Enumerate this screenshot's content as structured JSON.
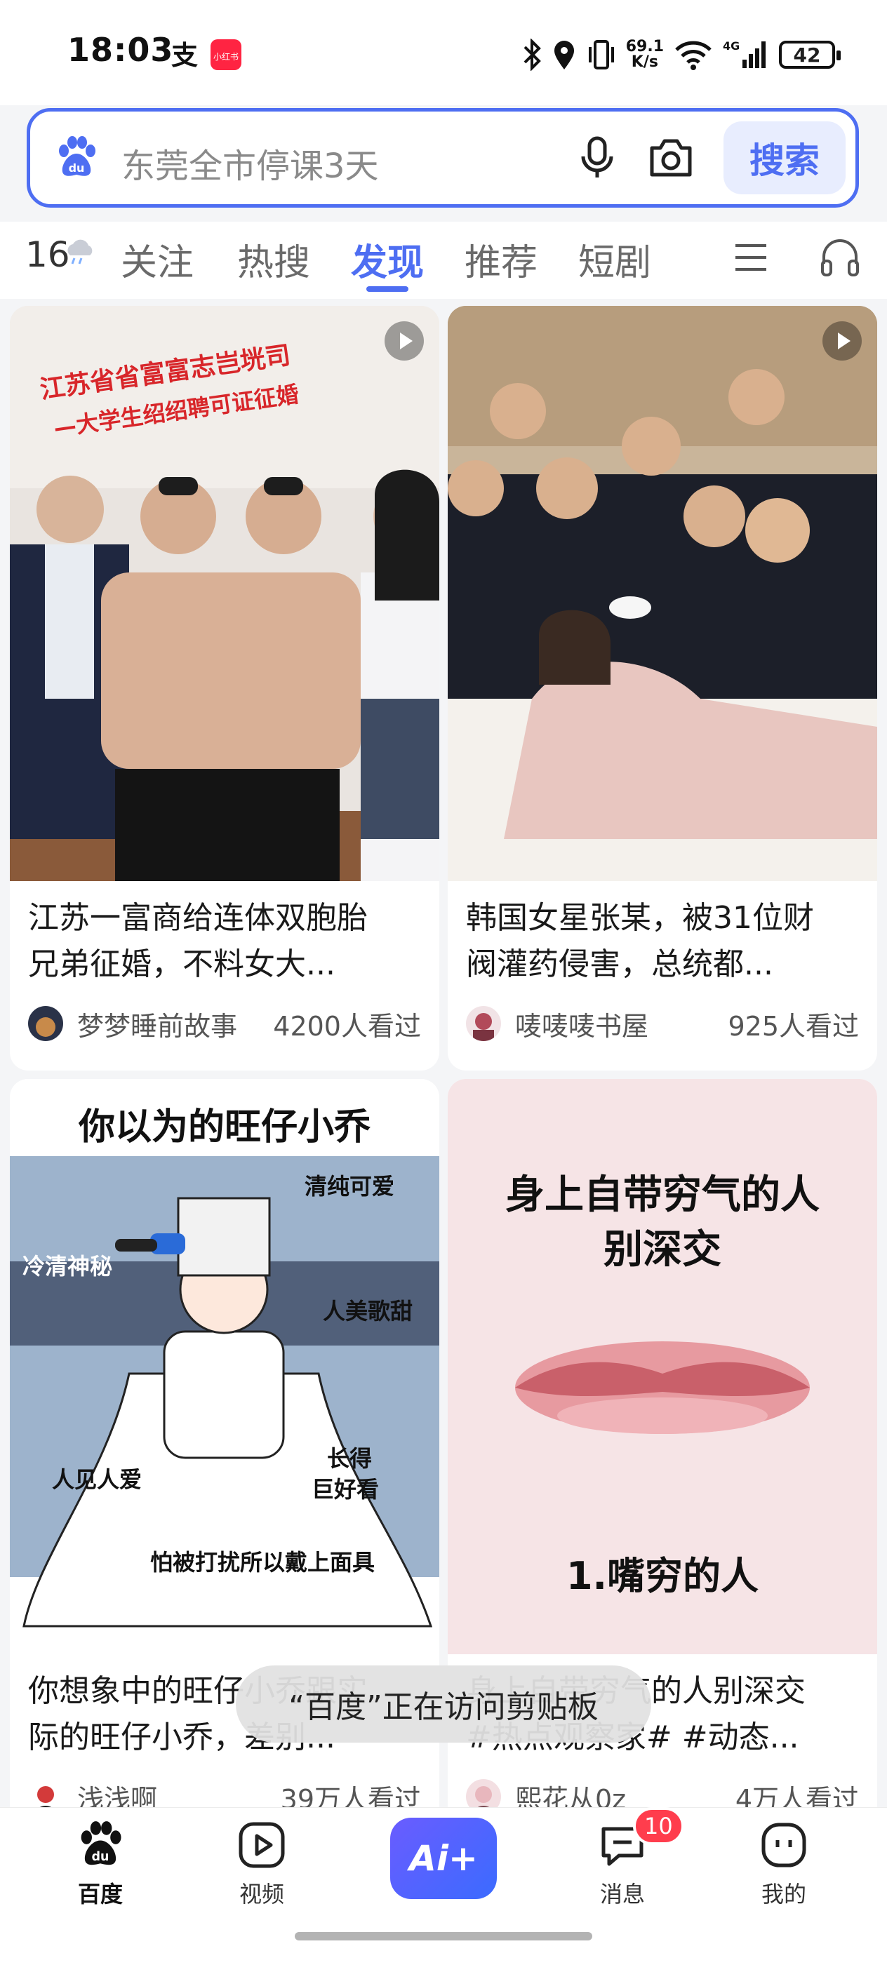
{
  "status_bar": {
    "time": "18:03",
    "net_speed_value": "69.1",
    "net_speed_unit": "K/s",
    "network": "4G",
    "wifi_label": "6",
    "battery": "42",
    "app_icons": [
      "alipay-icon",
      "xiaohongshu-icon"
    ]
  },
  "search": {
    "query": "东莞全市停课3天",
    "button_label": "搜索",
    "accent_color": "#4e6ef2"
  },
  "tabs": {
    "weather": "16°",
    "items": [
      {
        "label": "关注",
        "active": false
      },
      {
        "label": "热搜",
        "active": false
      },
      {
        "label": "发现",
        "active": true
      },
      {
        "label": "推荐",
        "active": false
      },
      {
        "label": "短剧",
        "active": false
      }
    ]
  },
  "feed": {
    "cards": [
      {
        "title_line1": "江苏一富商给连体双胞胎",
        "title_line2": "兄弟征婚，不料女大...",
        "author": "梦梦睡前故事",
        "views": "4200人看过",
        "has_video": true,
        "image_banner_line1": "江苏省省富富志岂垙司",
        "image_banner_line2": "—大学生绍绍聘可证征婚"
      },
      {
        "title_line1": "韩国女星张某，被31位财",
        "title_line2": "阀灌药侵害，总统都...",
        "author": "唛唛唛书屋",
        "views": "925人看过",
        "has_video": true
      },
      {
        "title_line1": "你想象中的旺仔小乔跟实",
        "title_line2": "际的旺仔小乔，差别...",
        "author": "浅浅啊",
        "views": "39万人看过",
        "has_video": false,
        "image_heading": "你以为的旺仔小乔",
        "image_labels": [
          "清纯可爱",
          "冷清神秘",
          "人美歌甜",
          "人见人爱",
          "长得",
          "巨好看",
          "怕被打扰所以戴上面具"
        ]
      },
      {
        "title_line1": "身上自带穷气的人别深交",
        "title_line2": "#热点观察家# #动态...",
        "author": "熙花从0z",
        "views": "4万人看过",
        "has_video": false,
        "image_heading_line1": "身上自带穷气的人",
        "image_heading_line2": "别深交",
        "image_caption": "1.嘴穷的人"
      }
    ]
  },
  "toast": {
    "text": "“百度”正在访问剪贴板"
  },
  "bottom_nav": {
    "items": [
      {
        "label": "百度",
        "active": true
      },
      {
        "label": "视频",
        "active": false
      },
      {
        "label": "Ai+",
        "active": false
      },
      {
        "label": "消息",
        "active": false,
        "badge": "10"
      },
      {
        "label": "我的",
        "active": false
      }
    ]
  }
}
